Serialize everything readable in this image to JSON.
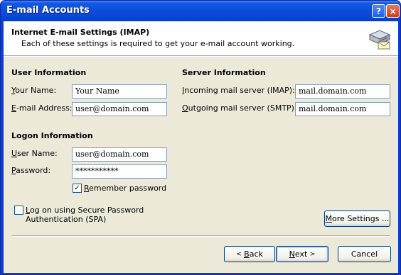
{
  "window": {
    "title": "E-mail Accounts",
    "help_glyph": "?",
    "close_glyph": "×"
  },
  "header": {
    "title": "Internet E-mail Settings (IMAP)",
    "subtitle": "Each of these settings is required to get your e-mail account working.",
    "icon": "mail-server-icon"
  },
  "user_info": {
    "heading": "User Information",
    "your_name_label": {
      "key": "Y",
      "rest": "our Name:"
    },
    "your_name_value": "Your Name",
    "email_label": {
      "key": "E",
      "rest": "-mail Address:"
    },
    "email_value": "user@domain.com"
  },
  "server_info": {
    "heading": "Server Information",
    "incoming_label": {
      "key": "I",
      "rest": "ncoming mail server (IMAP):"
    },
    "incoming_value": "mail.domain.com",
    "outgoing_label": {
      "key": "O",
      "rest": "utgoing mail server (SMTP):"
    },
    "outgoing_value": "mail.domain.com"
  },
  "logon_info": {
    "heading": "Logon Information",
    "user_name_label": {
      "key": "U",
      "rest": "ser Name:"
    },
    "user_name_value": "user@domain.com",
    "password_label": {
      "key": "P",
      "rest": "assword:"
    },
    "password_value": "***********",
    "remember": {
      "key": "R",
      "rest": "emember password",
      "checked": true,
      "mark": "✓"
    }
  },
  "spa": {
    "checked": false,
    "line1": {
      "key": "L",
      "rest": "og on using Secure Password"
    },
    "line2": "Authentication (SPA)"
  },
  "buttons": {
    "more_settings": {
      "key": "M",
      "rest": "ore Settings ..."
    },
    "back": {
      "chevron": "<",
      "key": "B",
      "rest": "ack"
    },
    "next": {
      "key": "N",
      "rest": "ext",
      "chevron": ">"
    },
    "cancel": "Cancel"
  },
  "colors": {
    "titlebar": "#0a4ddb",
    "face": "#ece9d8",
    "field_border": "#7f9db9",
    "button_border": "#003c74"
  }
}
